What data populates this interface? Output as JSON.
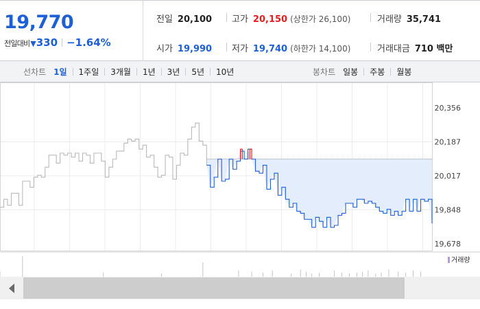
{
  "summary": {
    "price": "19,770",
    "change_label": "전일대비",
    "change_arrow": "▼",
    "change_amount": "330",
    "change_rate": "−1.64%",
    "prev_close_label": "전일",
    "prev_close": "20,100",
    "open_label": "시가",
    "open": "19,990",
    "high_label": "고가",
    "high": "20,150",
    "upper_limit": "(상한가 26,100)",
    "low_label": "저가",
    "low": "19,740",
    "lower_limit": "(하한가 14,100)",
    "volume_label": "거래량",
    "volume": "35,741",
    "value_label": "거래대금",
    "value": "710 백만"
  },
  "toolbar": {
    "line_label": "선차트",
    "line_periods": [
      "1일",
      "1주일",
      "3개월",
      "1년",
      "3년",
      "5년",
      "10년"
    ],
    "active_period": "1일",
    "candle_label": "봉차트",
    "candle_periods": [
      "일봉",
      "주봉",
      "월봉"
    ]
  },
  "colors": {
    "accent_blue": "#1d5fd6",
    "rise_red": "#e02020",
    "previous_day_line": "#b9b9b9",
    "fill_below_close": "#e3edfb",
    "volume_legend": "#b69ad6"
  },
  "chart_data": {
    "type": "line",
    "ylim": [
      19678,
      20356
    ],
    "y_ticks": [
      "20,356",
      "20,187",
      "20,017",
      "19,848",
      "19,678"
    ],
    "reference_close": 20100,
    "volume_legend": "거래량",
    "series": [
      {
        "points": [
          [
            0,
            19860
          ],
          [
            2,
            19900
          ],
          [
            4,
            19870
          ],
          [
            6,
            19930
          ],
          [
            8,
            19930
          ],
          [
            10,
            19870
          ],
          [
            12,
            19990
          ],
          [
            14,
            19990
          ],
          [
            16,
            19960
          ],
          [
            18,
            20010
          ],
          [
            20,
            20020
          ],
          [
            22,
            20010
          ],
          [
            24,
            20060
          ],
          [
            26,
            20120
          ],
          [
            28,
            20120
          ],
          [
            30,
            20080
          ],
          [
            32,
            20130
          ],
          [
            34,
            20120
          ],
          [
            36,
            20130
          ],
          [
            38,
            20110
          ],
          [
            40,
            20130
          ],
          [
            42,
            20090
          ],
          [
            44,
            20130
          ],
          [
            46,
            20120
          ],
          [
            48,
            20080
          ],
          [
            50,
            20130
          ],
          [
            52,
            20130
          ],
          [
            54,
            20090
          ],
          [
            56,
            20010
          ],
          [
            58,
            20060
          ],
          [
            60,
            20100
          ],
          [
            62,
            20140
          ],
          [
            64,
            20140
          ],
          [
            66,
            20180
          ],
          [
            68,
            20200
          ],
          [
            70,
            20190
          ],
          [
            72,
            20200
          ],
          [
            74,
            20150
          ],
          [
            76,
            20170
          ],
          [
            78,
            20110
          ],
          [
            80,
            20120
          ],
          [
            82,
            20060
          ],
          [
            84,
            20010
          ],
          [
            86,
            20020
          ],
          [
            88,
            20120
          ],
          [
            90,
            20110
          ],
          [
            92,
            20000
          ],
          [
            94,
            20070
          ],
          [
            96,
            20130
          ],
          [
            98,
            20120
          ],
          [
            100,
            20200
          ],
          [
            102,
            20260
          ],
          [
            104,
            20280
          ],
          [
            106,
            20190
          ],
          [
            108,
            20170
          ],
          [
            110,
            20070
          ]
        ],
        "color": "#b9b9b9"
      },
      {
        "points": [
          [
            110,
            20070
          ],
          [
            112,
            19960
          ],
          [
            114,
            20010
          ],
          [
            116,
            20100
          ],
          [
            118,
            19990
          ],
          [
            120,
            20000
          ],
          [
            122,
            20100
          ],
          [
            124,
            20050
          ],
          [
            126,
            20090
          ],
          [
            128,
            20140
          ],
          [
            130,
            20100
          ],
          [
            132,
            20150
          ],
          [
            134,
            20100
          ],
          [
            136,
            20040
          ],
          [
            138,
            20030
          ],
          [
            140,
            20070
          ],
          [
            142,
            19950
          ],
          [
            144,
            20000
          ],
          [
            146,
            20030
          ],
          [
            148,
            19920
          ],
          [
            150,
            19960
          ],
          [
            152,
            19900
          ],
          [
            154,
            19860
          ],
          [
            156,
            19880
          ],
          [
            158,
            19840
          ],
          [
            160,
            19830
          ],
          [
            162,
            19800
          ],
          [
            164,
            19800
          ],
          [
            166,
            19760
          ],
          [
            168,
            19810
          ],
          [
            170,
            19790
          ],
          [
            172,
            19760
          ],
          [
            174,
            19810
          ],
          [
            176,
            19760
          ],
          [
            178,
            19770
          ],
          [
            180,
            19820
          ],
          [
            182,
            19830
          ],
          [
            184,
            19880
          ],
          [
            186,
            19880
          ],
          [
            188,
            19860
          ],
          [
            190,
            19900
          ],
          [
            192,
            19900
          ],
          [
            194,
            19880
          ],
          [
            196,
            19890
          ],
          [
            198,
            19880
          ],
          [
            200,
            19860
          ],
          [
            202,
            19840
          ],
          [
            204,
            19830
          ],
          [
            206,
            19850
          ],
          [
            208,
            19820
          ],
          [
            210,
            19840
          ],
          [
            212,
            19820
          ],
          [
            214,
            19840
          ],
          [
            216,
            19900
          ],
          [
            218,
            19840
          ],
          [
            220,
            19900
          ],
          [
            222,
            19840
          ],
          [
            224,
            19900
          ],
          [
            226,
            19890
          ],
          [
            228,
            19900
          ],
          [
            230,
            19780
          ]
        ],
        "color": "#1d5fd6"
      },
      {
        "points": [
          [
            128,
            20100
          ],
          [
            128,
            20150
          ],
          [
            129,
            20100
          ]
        ],
        "color": "#e02020"
      },
      {
        "points": [
          [
            133,
            20100
          ],
          [
            133,
            20150
          ],
          [
            134,
            20100
          ]
        ],
        "color": "#e02020"
      }
    ],
    "volume": {
      "x": [
        0,
        12,
        55,
        86,
        108,
        127,
        134,
        140,
        145,
        155,
        160,
        163,
        166,
        170,
        178,
        182,
        186,
        190,
        193,
        196,
        200,
        203,
        207,
        212,
        216,
        220,
        224
      ],
      "values": [
        0.25,
        1.0,
        0.2,
        0.15,
        0.7,
        0.3,
        0.25,
        0.2,
        0.3,
        0.15,
        0.35,
        0.25,
        0.15,
        0.2,
        0.3,
        0.2,
        0.15,
        0.2,
        0.25,
        0.3,
        0.15,
        0.2,
        0.35,
        0.25,
        0.2,
        0.3,
        0.25
      ]
    }
  }
}
